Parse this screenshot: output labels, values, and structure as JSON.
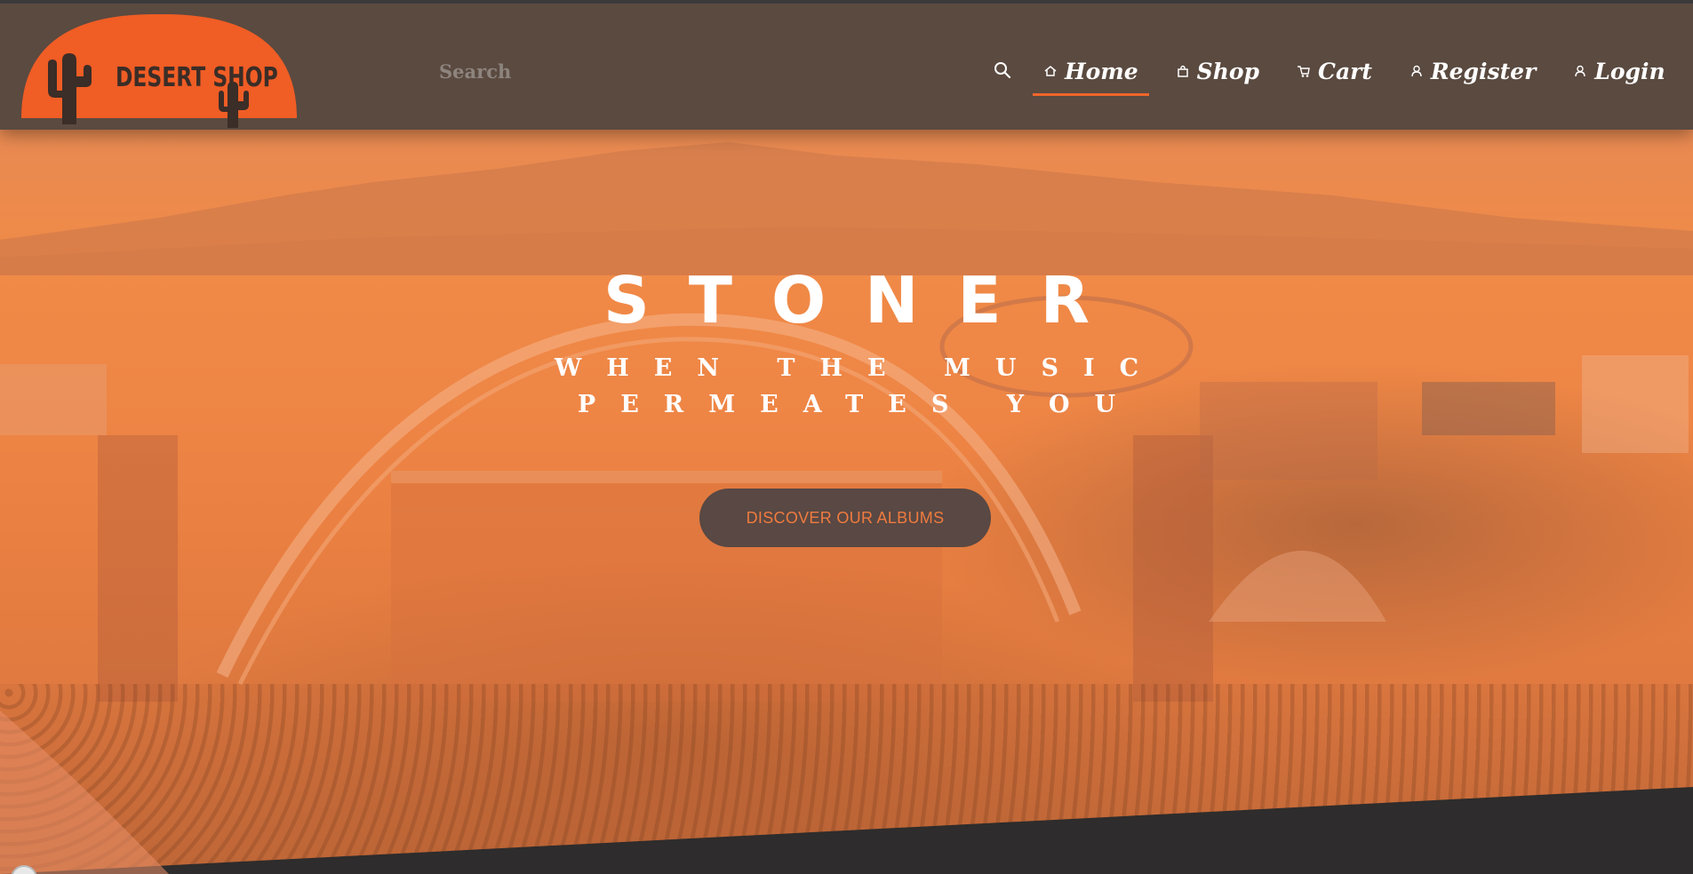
{
  "header": {
    "logo": {
      "text": "DESERT SHOP"
    },
    "search": {
      "placeholder": "Search"
    },
    "nav": [
      {
        "label": "Home",
        "icon": "home-icon",
        "active": true
      },
      {
        "label": "Shop",
        "icon": "shopping-bag-icon"
      },
      {
        "label": "Cart",
        "icon": "cart-icon"
      },
      {
        "label": "Register",
        "icon": "user-icon"
      },
      {
        "label": "Login",
        "icon": "user-icon"
      }
    ]
  },
  "hero": {
    "title": "STONER",
    "subtitle_line1": "WHEN THE MUSIC",
    "subtitle_line2": "PERMEATES YOU",
    "cta_label": "DISCOVER OUR ALBUMS"
  },
  "colors": {
    "accent": "#f0662a",
    "header_bg": "#5a4a40",
    "cta_bg": "#594843",
    "cta_text": "#f07b3f",
    "footer_band": "#2e2c2c"
  }
}
